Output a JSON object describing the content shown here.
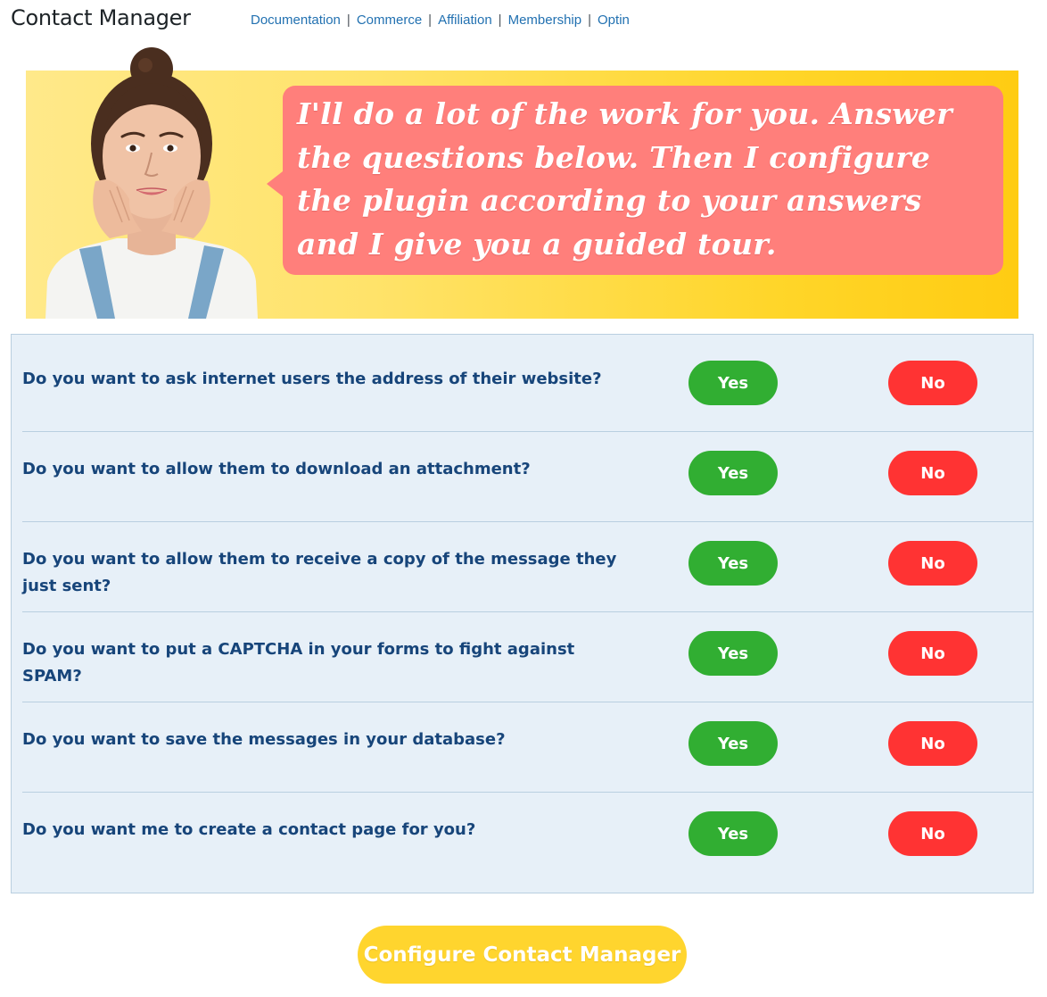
{
  "app": {
    "title": "Contact Manager"
  },
  "nav": {
    "items": [
      {
        "label": "Documentation"
      },
      {
        "label": "Commerce"
      },
      {
        "label": "Affiliation"
      },
      {
        "label": "Membership"
      },
      {
        "label": "Optin"
      }
    ],
    "separator": "|"
  },
  "banner": {
    "message": "I'll do a lot of the work for you. Answer the questions below. Then I configure the plugin according to your answers and I give you a guided tour.",
    "colors": {
      "background_start": "#ffe98a",
      "background_end": "#ffcc12",
      "bubble": "#ff7f7b"
    }
  },
  "questions": [
    {
      "text": "Do you want to ask internet users the address of their website?",
      "yes_label": "Yes",
      "no_label": "No"
    },
    {
      "text": "Do you want to allow them to download an attachment?",
      "yes_label": "Yes",
      "no_label": "No"
    },
    {
      "text": "Do you want to allow them to receive a copy of the message they just sent?",
      "yes_label": "Yes",
      "no_label": "No"
    },
    {
      "text": "Do you want to put a CAPTCHA in your forms to fight against SPAM?",
      "yes_label": "Yes",
      "no_label": "No"
    },
    {
      "text": "Do you want to save the messages in your database?",
      "yes_label": "Yes",
      "no_label": "No"
    },
    {
      "text": "Do you want me to create a contact page for you?",
      "yes_label": "Yes",
      "no_label": "No"
    }
  ],
  "cta": {
    "label": "Configure Contact Manager"
  },
  "colors": {
    "yes": "#31ae32",
    "no": "#ff3333",
    "question_text": "#17457a",
    "panel_bg": "#e7f0f8",
    "cta": "#ffd52e",
    "link": "#2271b1"
  }
}
